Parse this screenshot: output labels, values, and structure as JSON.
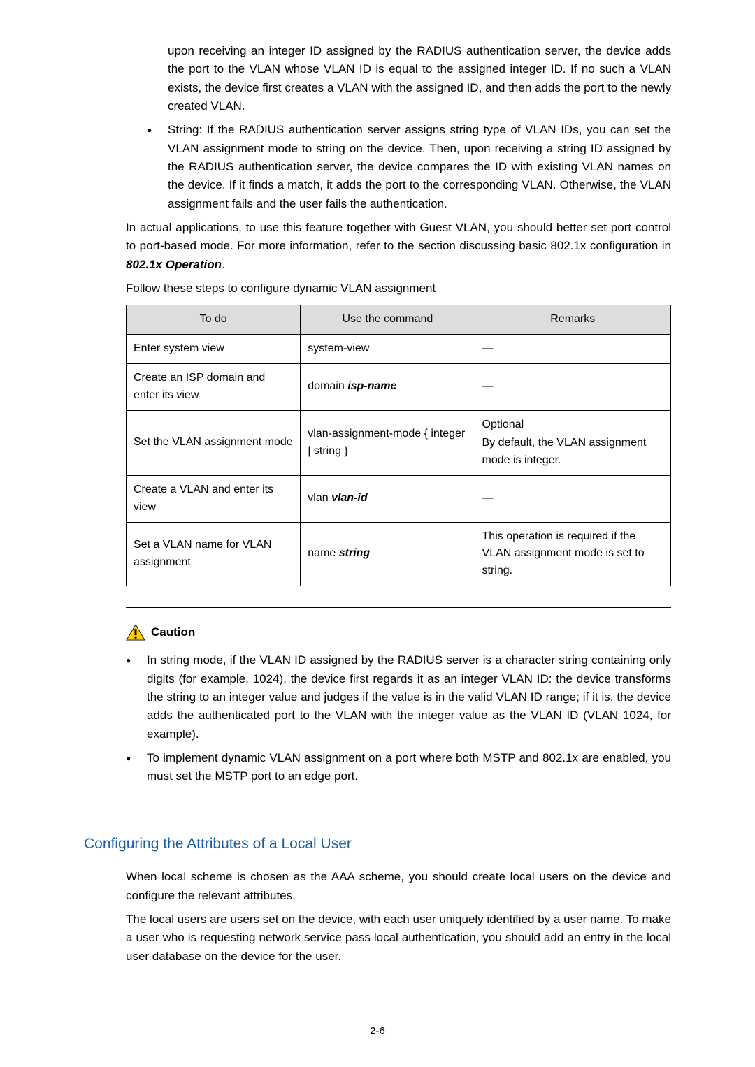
{
  "para_upon": "upon receiving an integer ID assigned by the RADIUS authentication server, the device adds the port to the VLAN whose VLAN ID is equal to the assigned integer ID. If no such a VLAN exists, the device first creates a VLAN with the assigned ID, and then adds the port to the newly created VLAN.",
  "bullet_string": "String: If the RADIUS authentication server assigns string type of VLAN IDs, you can set the VLAN assignment mode to string on the device. Then, upon receiving a string ID assigned by the RADIUS authentication server, the device compares the ID with existing VLAN names on the device. If it finds a match, it adds the port to the corresponding VLAN. Otherwise, the VLAN assignment fails and the user fails the authentication.",
  "para_actual_pre": "In actual applications, to use this feature together with Guest VLAN, you should better set port control to port-based mode. For more information, refer to the section discussing basic 802.1x configuration in ",
  "para_actual_bold": "802.1x Operation",
  "para_actual_post": ".",
  "para_follow": "Follow these steps to configure dynamic VLAN assignment",
  "table": {
    "headers": {
      "todo": "To do",
      "cmd": "Use the command",
      "rem": "Remarks"
    },
    "rows": [
      {
        "todo": "Enter system view",
        "cmd": "system-view",
        "cmd_arg": "",
        "rem1": "—",
        "rem2": ""
      },
      {
        "todo": "Create an ISP domain and enter its view",
        "cmd": "domain ",
        "cmd_arg": "isp-name",
        "rem1": "—",
        "rem2": ""
      },
      {
        "todo": "Set the VLAN assignment mode",
        "cmd": "vlan-assignment-mode { integer | string  }",
        "cmd_arg": "",
        "rem1": "Optional",
        "rem2": "By default, the VLAN assignment mode is integer."
      },
      {
        "todo": "Create a VLAN and enter its view",
        "cmd": "vlan ",
        "cmd_arg": "vlan-id",
        "rem1": "—",
        "rem2": ""
      },
      {
        "todo": "Set a VLAN name for VLAN assignment",
        "cmd": "name ",
        "cmd_arg": "string",
        "rem1": "This operation is required if the VLAN assignment mode is set to string.",
        "rem2": ""
      }
    ]
  },
  "caution_label": "Caution",
  "caution1": "In string mode, if the VLAN ID assigned by the RADIUS server is a character string containing only digits (for example, 1024), the device first regards it as an integer VLAN ID: the device transforms the string to an integer value and judges if the value is in the valid VLAN ID range; if it is, the device adds the authenticated port to the VLAN with the integer value as the VLAN ID (VLAN 1024, for example).",
  "caution2": "To implement dynamic VLAN assignment on a port where both MSTP and 802.1x are enabled, you must set the MSTP port to an edge port.",
  "section_heading": "Configuring the Attributes of a Local User",
  "para_local1": "When local  scheme is chosen as the AAA scheme, you should create local users on the device and configure the relevant attributes.",
  "para_local2": "The local users are users set on the device, with each user uniquely identified by a user name. To make a user who is requesting network service pass local authentication, you should add an entry in the local user database on the device for the user.",
  "page_number": "2-6"
}
